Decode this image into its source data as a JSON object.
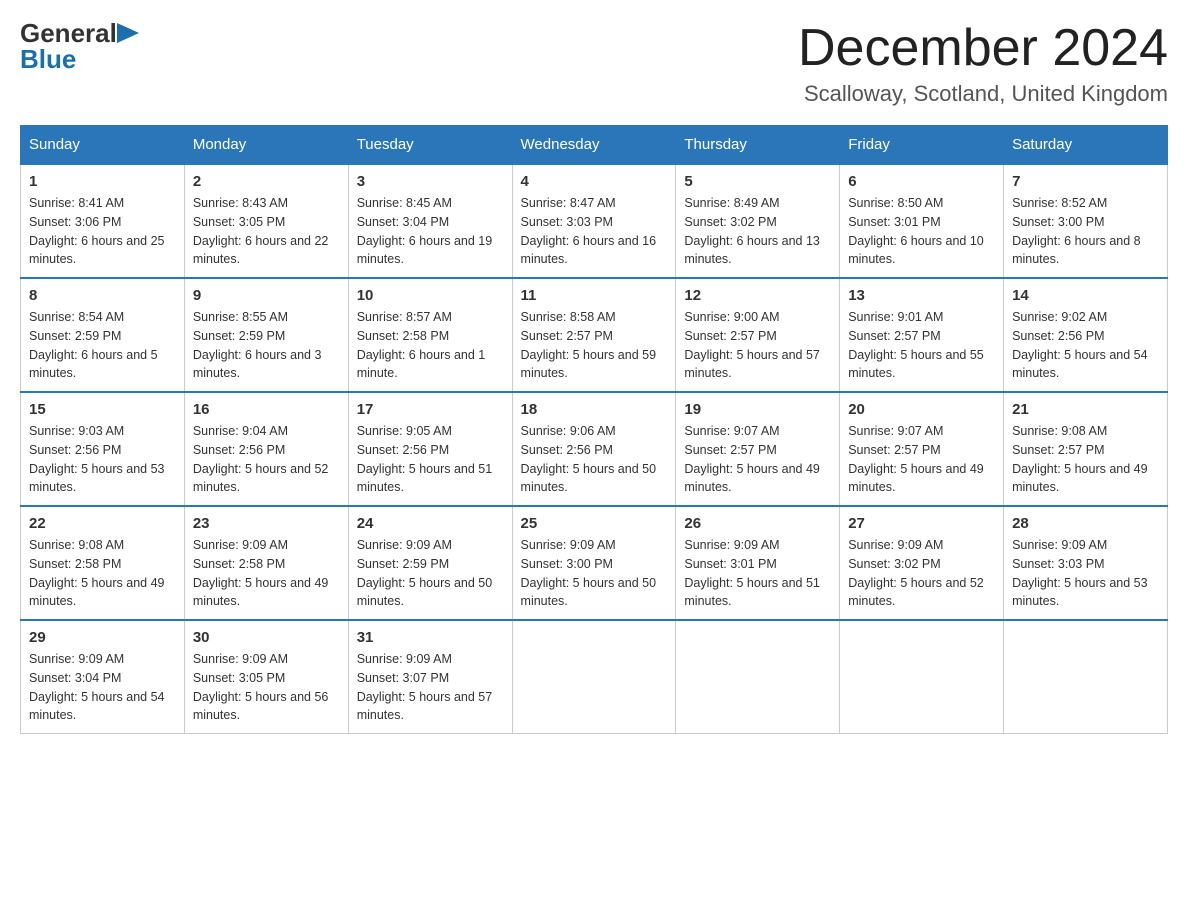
{
  "header": {
    "logo_general": "General",
    "logo_blue": "Blue",
    "title": "December 2024",
    "subtitle": "Scalloway, Scotland, United Kingdom"
  },
  "days_of_week": [
    "Sunday",
    "Monday",
    "Tuesday",
    "Wednesday",
    "Thursday",
    "Friday",
    "Saturday"
  ],
  "weeks": [
    [
      {
        "day": "1",
        "sunrise": "8:41 AM",
        "sunset": "3:06 PM",
        "daylight": "6 hours and 25 minutes."
      },
      {
        "day": "2",
        "sunrise": "8:43 AM",
        "sunset": "3:05 PM",
        "daylight": "6 hours and 22 minutes."
      },
      {
        "day": "3",
        "sunrise": "8:45 AM",
        "sunset": "3:04 PM",
        "daylight": "6 hours and 19 minutes."
      },
      {
        "day": "4",
        "sunrise": "8:47 AM",
        "sunset": "3:03 PM",
        "daylight": "6 hours and 16 minutes."
      },
      {
        "day": "5",
        "sunrise": "8:49 AM",
        "sunset": "3:02 PM",
        "daylight": "6 hours and 13 minutes."
      },
      {
        "day": "6",
        "sunrise": "8:50 AM",
        "sunset": "3:01 PM",
        "daylight": "6 hours and 10 minutes."
      },
      {
        "day": "7",
        "sunrise": "8:52 AM",
        "sunset": "3:00 PM",
        "daylight": "6 hours and 8 minutes."
      }
    ],
    [
      {
        "day": "8",
        "sunrise": "8:54 AM",
        "sunset": "2:59 PM",
        "daylight": "6 hours and 5 minutes."
      },
      {
        "day": "9",
        "sunrise": "8:55 AM",
        "sunset": "2:59 PM",
        "daylight": "6 hours and 3 minutes."
      },
      {
        "day": "10",
        "sunrise": "8:57 AM",
        "sunset": "2:58 PM",
        "daylight": "6 hours and 1 minute."
      },
      {
        "day": "11",
        "sunrise": "8:58 AM",
        "sunset": "2:57 PM",
        "daylight": "5 hours and 59 minutes."
      },
      {
        "day": "12",
        "sunrise": "9:00 AM",
        "sunset": "2:57 PM",
        "daylight": "5 hours and 57 minutes."
      },
      {
        "day": "13",
        "sunrise": "9:01 AM",
        "sunset": "2:57 PM",
        "daylight": "5 hours and 55 minutes."
      },
      {
        "day": "14",
        "sunrise": "9:02 AM",
        "sunset": "2:56 PM",
        "daylight": "5 hours and 54 minutes."
      }
    ],
    [
      {
        "day": "15",
        "sunrise": "9:03 AM",
        "sunset": "2:56 PM",
        "daylight": "5 hours and 53 minutes."
      },
      {
        "day": "16",
        "sunrise": "9:04 AM",
        "sunset": "2:56 PM",
        "daylight": "5 hours and 52 minutes."
      },
      {
        "day": "17",
        "sunrise": "9:05 AM",
        "sunset": "2:56 PM",
        "daylight": "5 hours and 51 minutes."
      },
      {
        "day": "18",
        "sunrise": "9:06 AM",
        "sunset": "2:56 PM",
        "daylight": "5 hours and 50 minutes."
      },
      {
        "day": "19",
        "sunrise": "9:07 AM",
        "sunset": "2:57 PM",
        "daylight": "5 hours and 49 minutes."
      },
      {
        "day": "20",
        "sunrise": "9:07 AM",
        "sunset": "2:57 PM",
        "daylight": "5 hours and 49 minutes."
      },
      {
        "day": "21",
        "sunrise": "9:08 AM",
        "sunset": "2:57 PM",
        "daylight": "5 hours and 49 minutes."
      }
    ],
    [
      {
        "day": "22",
        "sunrise": "9:08 AM",
        "sunset": "2:58 PM",
        "daylight": "5 hours and 49 minutes."
      },
      {
        "day": "23",
        "sunrise": "9:09 AM",
        "sunset": "2:58 PM",
        "daylight": "5 hours and 49 minutes."
      },
      {
        "day": "24",
        "sunrise": "9:09 AM",
        "sunset": "2:59 PM",
        "daylight": "5 hours and 50 minutes."
      },
      {
        "day": "25",
        "sunrise": "9:09 AM",
        "sunset": "3:00 PM",
        "daylight": "5 hours and 50 minutes."
      },
      {
        "day": "26",
        "sunrise": "9:09 AM",
        "sunset": "3:01 PM",
        "daylight": "5 hours and 51 minutes."
      },
      {
        "day": "27",
        "sunrise": "9:09 AM",
        "sunset": "3:02 PM",
        "daylight": "5 hours and 52 minutes."
      },
      {
        "day": "28",
        "sunrise": "9:09 AM",
        "sunset": "3:03 PM",
        "daylight": "5 hours and 53 minutes."
      }
    ],
    [
      {
        "day": "29",
        "sunrise": "9:09 AM",
        "sunset": "3:04 PM",
        "daylight": "5 hours and 54 minutes."
      },
      {
        "day": "30",
        "sunrise": "9:09 AM",
        "sunset": "3:05 PM",
        "daylight": "5 hours and 56 minutes."
      },
      {
        "day": "31",
        "sunrise": "9:09 AM",
        "sunset": "3:07 PM",
        "daylight": "5 hours and 57 minutes."
      },
      null,
      null,
      null,
      null
    ]
  ],
  "labels": {
    "sunrise": "Sunrise:",
    "sunset": "Sunset:",
    "daylight": "Daylight:"
  }
}
